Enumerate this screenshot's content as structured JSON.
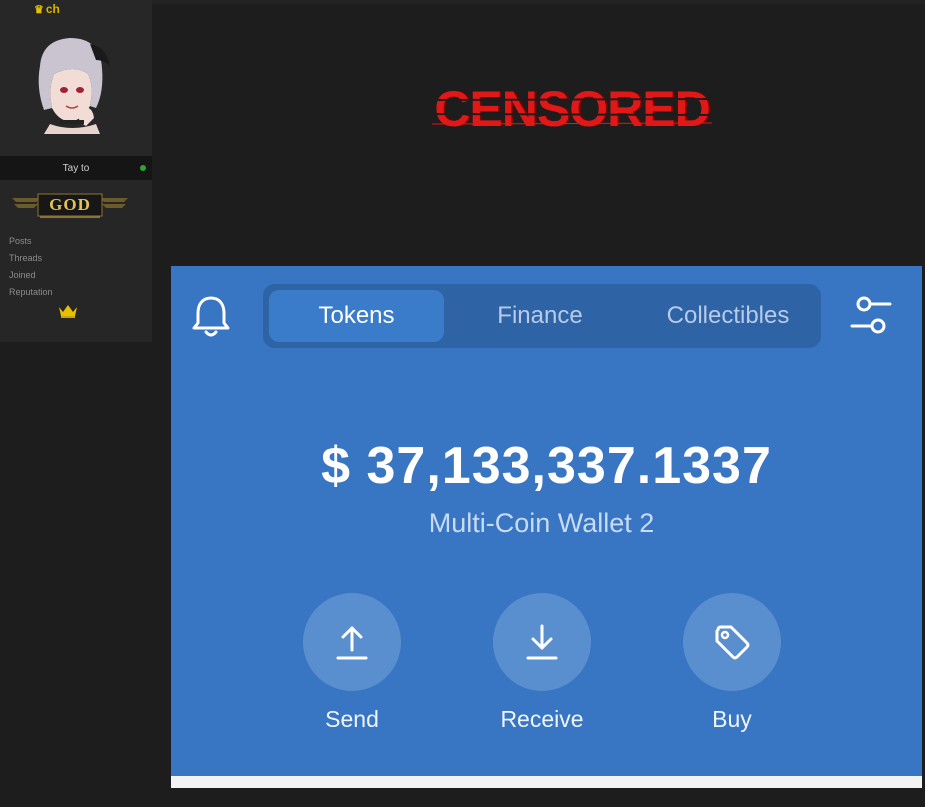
{
  "profile": {
    "username": "ch",
    "status_name": "Tay to",
    "rank": "GOD",
    "stats": [
      "Posts",
      "Threads",
      "Joined",
      "Reputation"
    ]
  },
  "header": {
    "censored_label": "CENSORED"
  },
  "wallet": {
    "tabs": [
      {
        "label": "Tokens"
      },
      {
        "label": "Finance"
      },
      {
        "label": "Collectibles"
      }
    ],
    "balance": "$ 37,133,337.1337",
    "wallet_name": "Multi-Coin Wallet 2",
    "actions": [
      {
        "label": "Send",
        "icon": "arrow-up-icon"
      },
      {
        "label": "Receive",
        "icon": "arrow-down-icon"
      },
      {
        "label": "Buy",
        "icon": "tag-icon"
      }
    ]
  },
  "colors": {
    "wallet_bg": "#3875c2",
    "tab_bar": "#2e63a6",
    "active_tab": "#3a7cc9",
    "censored": "#e01818",
    "rank_gold": "#e3c15a",
    "online": "#2fa33a"
  }
}
